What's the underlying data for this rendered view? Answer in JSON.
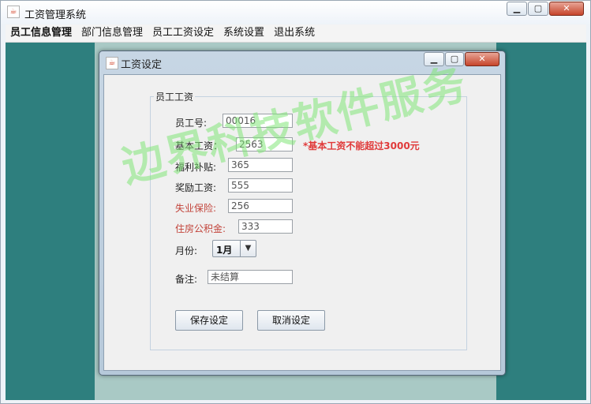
{
  "window": {
    "title": "工资管理系统"
  },
  "menubar": {
    "items": [
      "员工信息管理",
      "部门信息管理",
      "员工工资设定",
      "系统设置",
      "退出系统"
    ]
  },
  "dialog": {
    "title": "工资设定",
    "group_title": "员工工资",
    "fields": {
      "employee_id": {
        "label": "员工号:",
        "value": "00016"
      },
      "base_salary": {
        "label": "基本工资：",
        "value": "2563"
      },
      "welfare": {
        "label": "福利补贴:",
        "value": "365"
      },
      "bonus": {
        "label": "奖励工资:",
        "value": "555"
      },
      "unemployment": {
        "label": "失业保险:",
        "value": "256"
      },
      "housing_fund": {
        "label": "住房公积金:",
        "value": "333"
      },
      "month": {
        "label": "月份:",
        "value": "1月"
      },
      "remark": {
        "label": "备注:",
        "value": "未结算"
      }
    },
    "warning": "*基本工资不能超过3000元",
    "buttons": {
      "save": "保存设定",
      "cancel": "取消设定"
    }
  },
  "watermark": "边界科技软件服务",
  "colors": {
    "desktop": "#2e7f7e",
    "warning": "#e03a3a",
    "label_red": "#c2433a"
  }
}
